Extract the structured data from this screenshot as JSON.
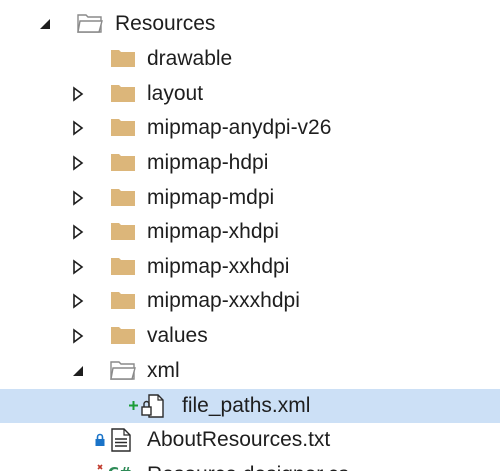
{
  "tree": {
    "root": {
      "label": "Resources",
      "expanded": true,
      "icon": "folder-open-icon"
    },
    "children": [
      {
        "label": "drawable",
        "expandable": false,
        "icon": "folder-icon"
      },
      {
        "label": "layout",
        "expandable": true,
        "icon": "folder-icon"
      },
      {
        "label": "mipmap-anydpi-v26",
        "expandable": true,
        "icon": "folder-icon"
      },
      {
        "label": "mipmap-hdpi",
        "expandable": true,
        "icon": "folder-icon"
      },
      {
        "label": "mipmap-mdpi",
        "expandable": true,
        "icon": "folder-icon"
      },
      {
        "label": "mipmap-xhdpi",
        "expandable": true,
        "icon": "folder-icon"
      },
      {
        "label": "mipmap-xxhdpi",
        "expandable": true,
        "icon": "folder-icon"
      },
      {
        "label": "mipmap-xxxhdpi",
        "expandable": true,
        "icon": "folder-icon"
      },
      {
        "label": "values",
        "expandable": true,
        "icon": "folder-icon"
      }
    ],
    "xml_folder": {
      "label": "xml",
      "expanded": true,
      "icon": "folder-open-icon"
    },
    "xml_file": {
      "label": "file_paths.xml",
      "selected": true,
      "icon": "xml-file-icon",
      "status": "added"
    },
    "about_file": {
      "label": "AboutResources.txt",
      "icon": "text-file-icon",
      "status": "locked"
    },
    "partial_item": {
      "label": "Resource.designer.cs",
      "icon": "csharp-file-icon"
    }
  },
  "colors": {
    "selection": "#cce0f6",
    "folder": "#dcb67a",
    "plus": "#1a9c35",
    "lock": "#1a73c8",
    "csharp": "#2e8b57",
    "csharp_red": "#c0392b"
  }
}
